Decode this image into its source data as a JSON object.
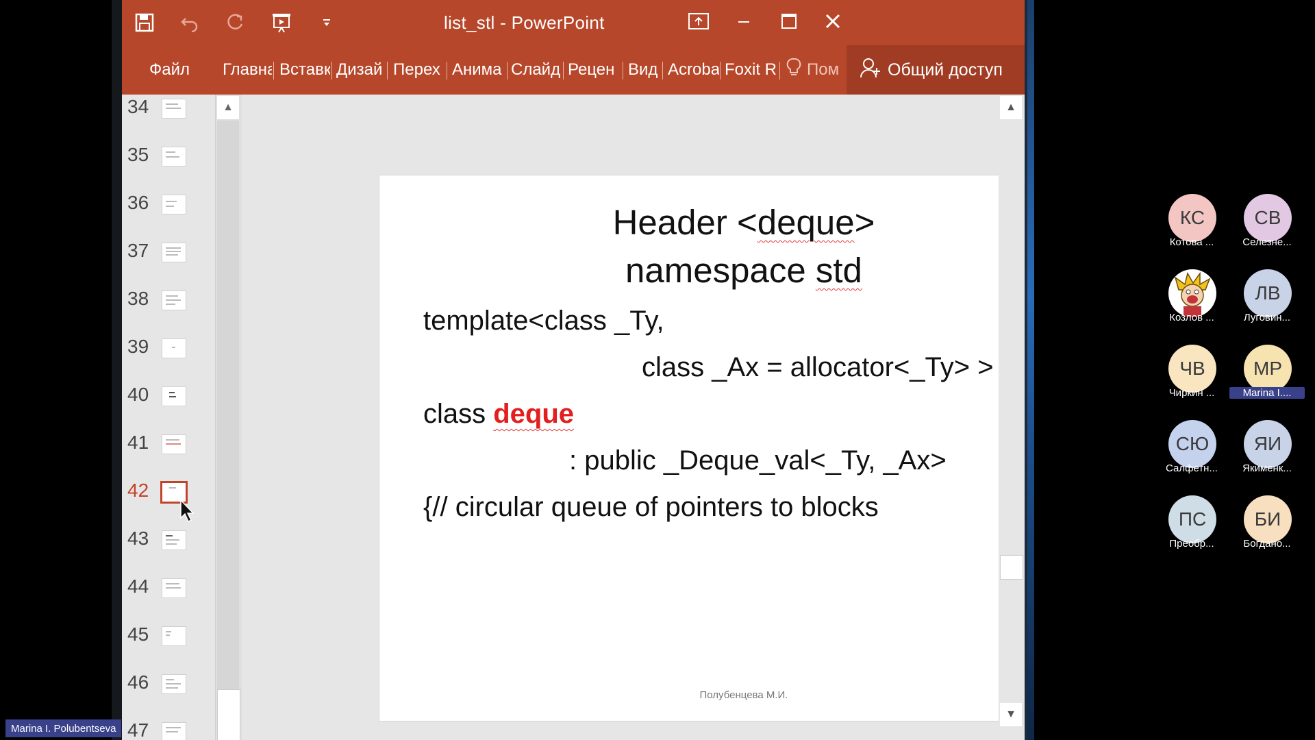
{
  "window": {
    "title": "list_stl  -  PowerPoint"
  },
  "ribbon": {
    "tabs": [
      "Файл",
      "Главна",
      "Вставк",
      "Дизай",
      "Перех",
      "Анима",
      "Слайд",
      "Рецен",
      "Вид",
      "Acroba",
      "Foxit R"
    ],
    "tell_me": "Пом",
    "share_label": "Общий доступ"
  },
  "thumbnails": {
    "slides": [
      "34",
      "35",
      "36",
      "37",
      "38",
      "39",
      "40",
      "41",
      "42",
      "43",
      "44",
      "45",
      "46",
      "47"
    ],
    "selected": "42"
  },
  "slide": {
    "title_line1": "Header <deque>",
    "title_line2": "namespace std",
    "line1": "template<class _Ty,",
    "line2": "class _Ax = allocator<_Ty> >",
    "line3_prefix": "class ",
    "line3_keyword": "deque",
    "line4": ": public _Deque_val<_Ty, _Ax>",
    "line5": "{// circular queue of pointers to blocks",
    "footer": "Полубенцева М.И."
  },
  "participants": [
    {
      "initials": "КС",
      "name": "Котова ...",
      "color": "#f3c6c3"
    },
    {
      "initials": "СВ",
      "name": "Селезне...",
      "color": "#e3c8e4"
    },
    {
      "initials": "",
      "name": "Козлов ...",
      "color": "#ffffff",
      "image": "cartoon-avatar"
    },
    {
      "initials": "ЛВ",
      "name": "Луговин...",
      "color": "#c9d3e8"
    },
    {
      "initials": "ЧВ",
      "name": "Чиркин ...",
      "color": "#f9e6c0"
    },
    {
      "initials": "МР",
      "name": "Marina I....",
      "color": "#f6e3b0"
    },
    {
      "initials": "СЮ",
      "name": "Салфетн...",
      "color": "#c5d2ee"
    },
    {
      "initials": "ЯИ",
      "name": "Якименк...",
      "color": "#c9d3e8"
    },
    {
      "initials": "ПС",
      "name": "Преобр...",
      "color": "#cfdde6"
    },
    {
      "initials": "БИ",
      "name": "Богдано...",
      "color": "#f7dfbf"
    }
  ],
  "presenter": {
    "name": "Marina I. Polubentseva"
  }
}
